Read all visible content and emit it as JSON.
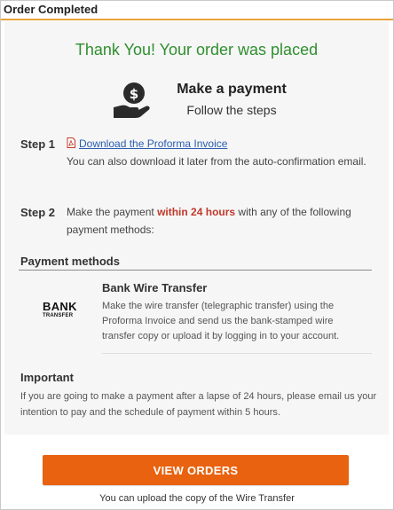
{
  "window": {
    "title": "Order Completed"
  },
  "header": {
    "thanks": "Thank You! Your order was placed",
    "payment_title": "Make a payment",
    "payment_subtitle": "Follow the steps",
    "icon": "hand-money-icon"
  },
  "steps": [
    {
      "label": "Step 1",
      "link": "Download the Proforma Invoice",
      "note": "You can also download it later from the auto-confirmation email.",
      "icon": "pdf-icon"
    },
    {
      "label": "Step 2",
      "text_before": "Make the payment ",
      "highlight": "within 24 hours",
      "text_after": " with any of the following payment methods:"
    }
  ],
  "payment_methods": {
    "title": "Payment methods",
    "items": [
      {
        "logo_big": "BANK",
        "logo_small": "TRANSFER",
        "name": "Bank Wire Transfer",
        "description": "Make the wire transfer (telegraphic transfer) using the Proforma Invoice and send us the bank-stamped wire transfer copy or upload it by logging in to your account."
      }
    ]
  },
  "important": {
    "title": "Important",
    "text": "If you are going to make a payment after a lapse of 24 hours, please email us your intention to pay and the schedule of payment within 5 hours."
  },
  "actions": {
    "view_orders": "VIEW ORDERS",
    "upload_note": "You can upload the copy of the Wire Transfer"
  },
  "colors": {
    "accent": "#e8620f",
    "success": "#2f8f2f",
    "highlight": "#c0392b",
    "link": "#2a5db0",
    "title_underline": "#e9a23b"
  }
}
